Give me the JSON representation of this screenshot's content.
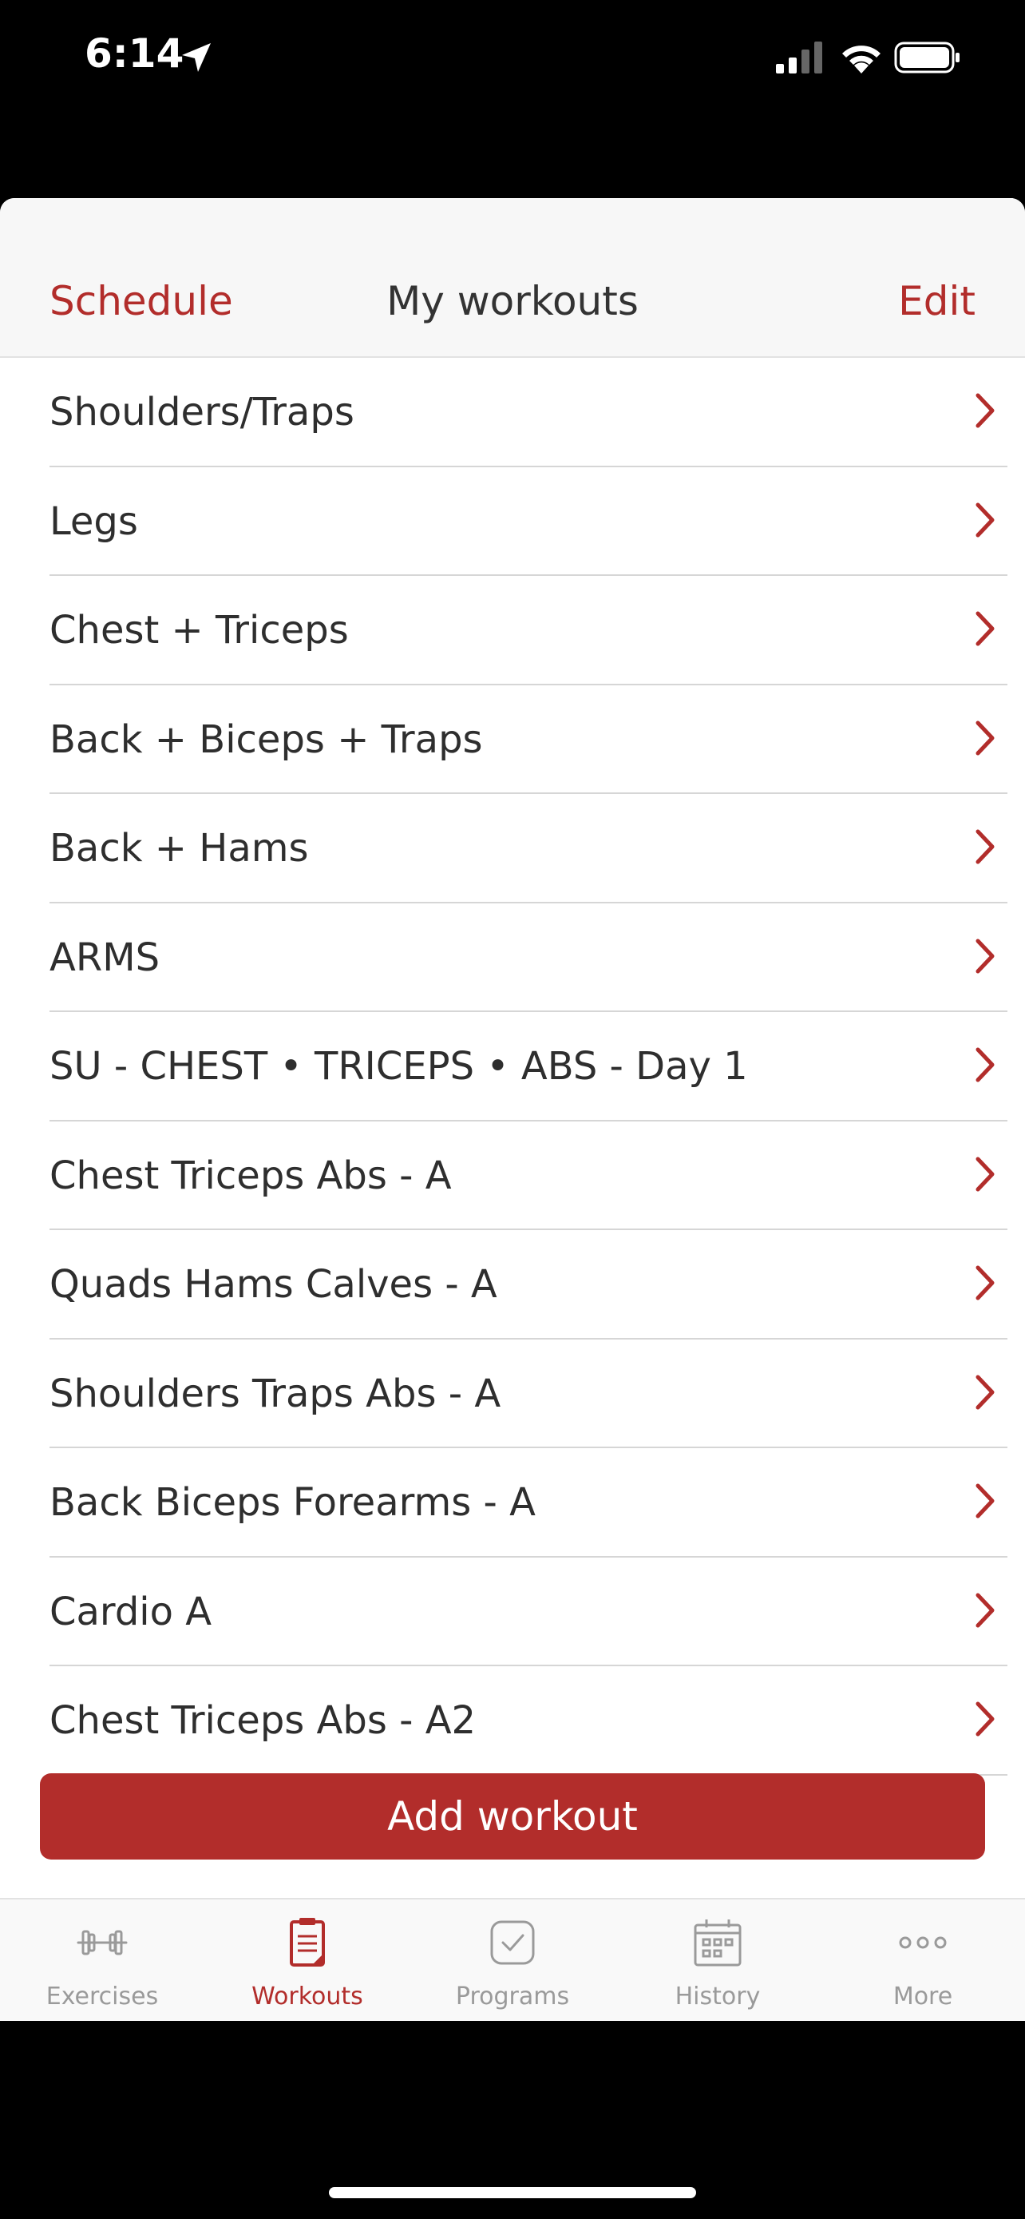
{
  "status_bar": {
    "time": "6:14"
  },
  "nav": {
    "left": "Schedule",
    "title": "My workouts",
    "right": "Edit"
  },
  "workouts": [
    "Shoulders/Traps",
    "Legs",
    "Chest + Triceps",
    "Back + Biceps + Traps",
    "Back + Hams",
    "ARMS",
    "SU - CHEST • TRICEPS • ABS - Day 1",
    "Chest Triceps Abs - A",
    "Quads Hams Calves - A",
    "Shoulders Traps Abs - A",
    "Back Biceps Forearms - A",
    "Cardio A",
    "Chest Triceps Abs - A2"
  ],
  "add_button": "Add workout",
  "tabs": [
    {
      "label": "Exercises",
      "icon": "dumbbell-icon",
      "active": false
    },
    {
      "label": "Workouts",
      "icon": "clipboard-icon",
      "active": true
    },
    {
      "label": "Programs",
      "icon": "checkmark-icon",
      "active": false
    },
    {
      "label": "History",
      "icon": "calendar-icon",
      "active": false
    },
    {
      "label": "More",
      "icon": "more-icon",
      "active": false
    }
  ],
  "colors": {
    "accent": "#b22d2b",
    "inactive": "#9a9a9a"
  }
}
